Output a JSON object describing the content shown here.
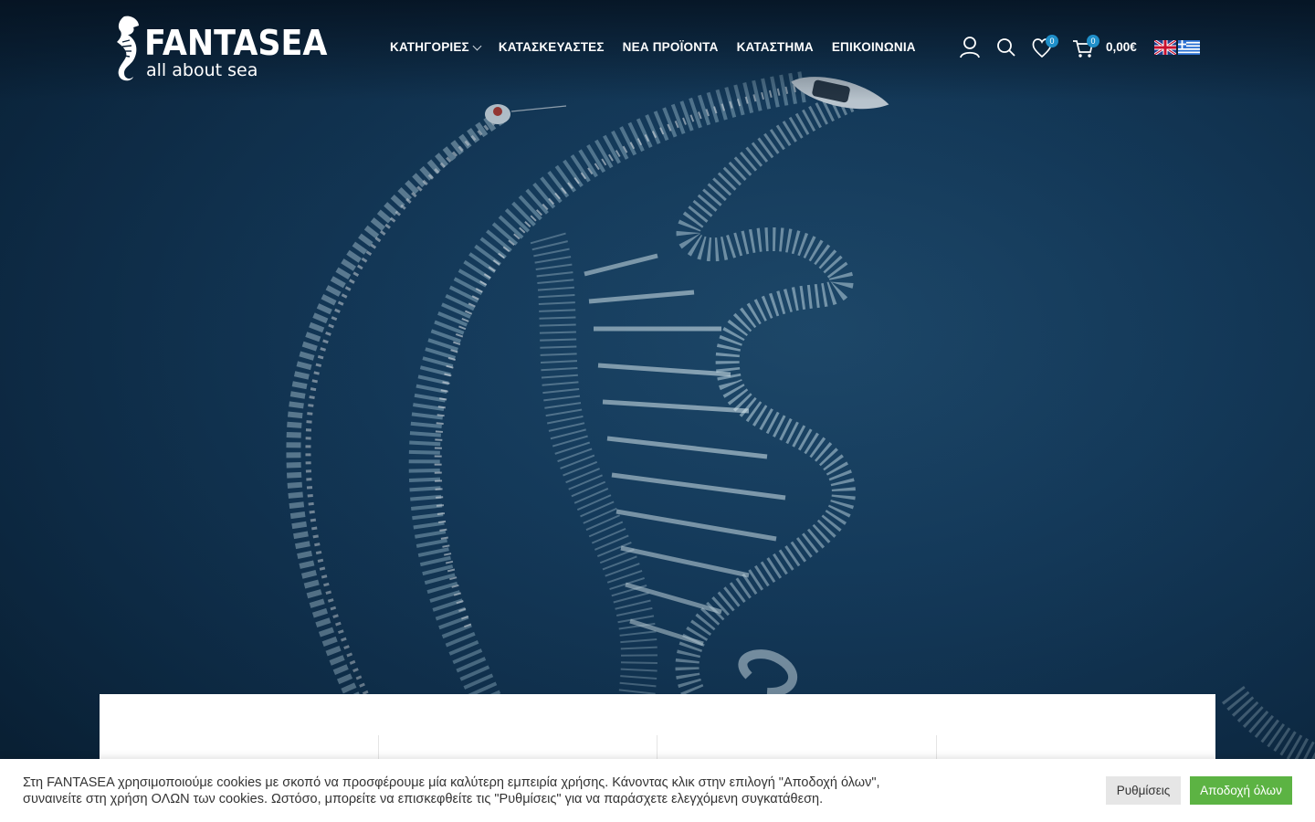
{
  "brand": {
    "title": "FANTASEA",
    "tagline": "all about sea"
  },
  "nav": {
    "items": [
      {
        "label": "ΚΑΤΗΓΟΡΙΕΣ",
        "has_dropdown": true
      },
      {
        "label": "ΚΑΤΑΣΚΕΥΑΣΤΕΣ"
      },
      {
        "label": "ΝΕΑ ΠΡΟΪΟΝΤΑ"
      },
      {
        "label": "ΚΑΤΑΣΤΗΜΑ"
      },
      {
        "label": "ΕΠΙΚΟΙΝΩΝΙΑ"
      }
    ]
  },
  "header_tools": {
    "account_icon": "user-icon",
    "search_icon": "search-icon",
    "wishlist_icon": "heart-icon",
    "wishlist_count": "0",
    "cart_icon": "cart-icon",
    "cart_count": "0",
    "cart_total": "0,00€",
    "languages": [
      "en-flag-icon",
      "gr-flag-icon"
    ]
  },
  "hero": {
    "image_icon": "seahorse-wake-photo"
  },
  "cookie": {
    "text": "Στη FANTASEA χρησιμοποιούμε cookies με σκοπό να προσφέρουμε μία καλύτερη εμπειρία χρήσης. Κάνοντας κλικ στην επιλογή \"Αποδοχή όλων\", συναινείτε στη χρήση ΟΛΩΝ των cookies. Ωστόσο, μπορείτε να επισκεφθείτε τις \"Ρυθμίσεις\" για να παράσχετε ελεγχόμενη συγκατάθεση.",
    "settings_label": "Ρυθμίσεις",
    "accept_label": "Αποδοχή όλων"
  },
  "colors": {
    "accent": "#1f8fc9",
    "accept_green": "#5cb343",
    "sea": "#143a5b"
  }
}
